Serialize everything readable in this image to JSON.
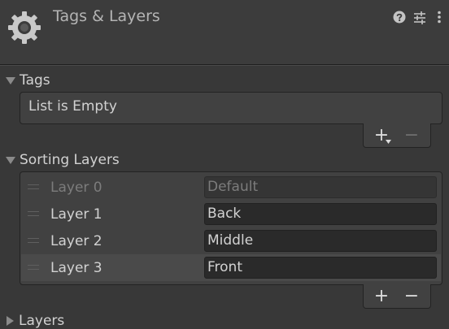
{
  "header": {
    "title": "Tags & Layers",
    "icons": [
      "gear-icon",
      "help-icon",
      "preset-icon",
      "more-icon"
    ]
  },
  "tags": {
    "label": "Tags",
    "empty_text": "List is Empty",
    "add_label": "+",
    "remove_label": "−"
  },
  "sorting_layers": {
    "label": "Sorting Layers",
    "add_label": "+",
    "remove_label": "−",
    "items": [
      {
        "label": "Layer 0",
        "name": "Default",
        "editable": false,
        "selected": false
      },
      {
        "label": "Layer 1",
        "name": "Back",
        "editable": true,
        "selected": false
      },
      {
        "label": "Layer 2",
        "name": "Middle",
        "editable": true,
        "selected": false
      },
      {
        "label": "Layer 3",
        "name": "Front",
        "editable": true,
        "selected": true
      }
    ]
  },
  "layers": {
    "label": "Layers"
  },
  "colors": {
    "background": "#383838",
    "header": "#3c3c3c",
    "text": "#d2d2d2",
    "disabled_text": "#7c7c7c",
    "field": "#2a2a2a",
    "selected_row": "#4a4a4a"
  }
}
